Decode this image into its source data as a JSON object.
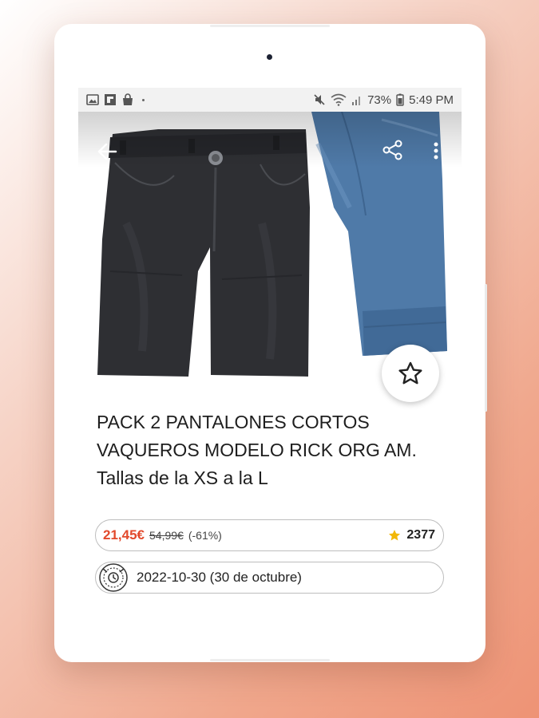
{
  "status_bar": {
    "battery": "73%",
    "time": "5:49 PM"
  },
  "product": {
    "title": "PACK 2 PANTALONES CORTOS VAQUEROS MODELO RICK ORG AM. Tallas de la XS a la L",
    "price": "21,45€",
    "old_price": "54,99€",
    "discount": "(-61%)",
    "rating_count": "2377",
    "date": "2022-10-30 (30 de octubre)"
  },
  "icons": {
    "back": "arrow-left-icon",
    "share": "share-icon",
    "more": "more-vert-icon",
    "favorite": "star-outline-icon",
    "rating": "star-filled-icon",
    "date": "calendar-clock-icon"
  },
  "colors": {
    "price": "#e2492c",
    "rating_star": "#f2b705",
    "dark_jeans": "#2e2f33",
    "light_jeans": "#4f7aa8"
  }
}
